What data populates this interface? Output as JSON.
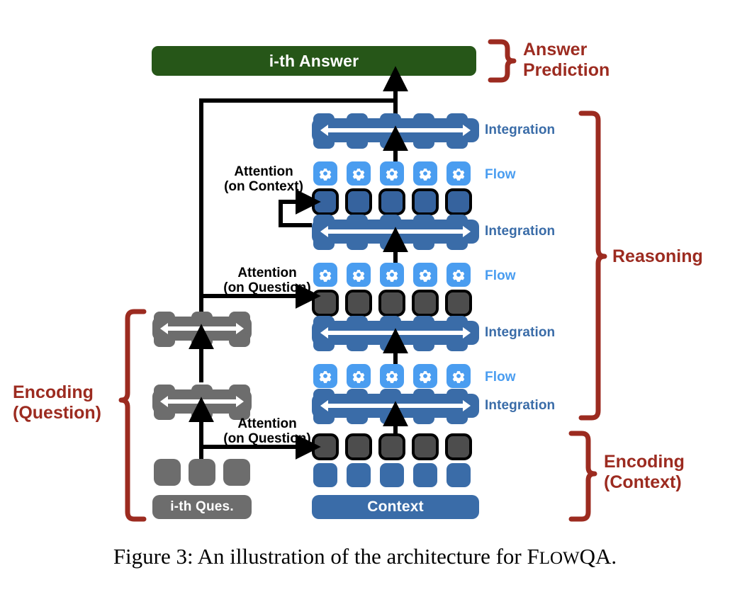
{
  "figure": {
    "caption_prefix": "Figure 3: An illustration of the architecture for ",
    "caption_smallcaps_lead": "F",
    "caption_smallcaps_rest": "LOW",
    "caption_suffix": "QA."
  },
  "colors": {
    "answer_green": "#265618",
    "integration_blue": "#3a6ca8",
    "flow_blue": "#4a9df0",
    "attention_dark_blue": "#36639e",
    "context_blue": "#3a6ca8",
    "question_gray": "#6d6d6d",
    "attention_gray": "#4d4d4d",
    "bracket_red": "#9c2b20",
    "arrow_black": "#000000",
    "label_flow": "#4a9df0",
    "label_integration": "#3a6ca8"
  },
  "answer": {
    "label": "i-th Answer"
  },
  "question": {
    "label": "i-th Ques.",
    "token_count": 3,
    "encoder_layers": 2
  },
  "context": {
    "label": "Context",
    "token_count": 5
  },
  "stack_labels": [
    {
      "text": "Integration",
      "kind": "integration"
    },
    {
      "text": "Flow",
      "kind": "flow"
    },
    {
      "text": "Integration",
      "kind": "integration"
    },
    {
      "text": "Flow",
      "kind": "flow"
    },
    {
      "text": "Integration",
      "kind": "integration"
    },
    {
      "text": "Flow",
      "kind": "flow"
    },
    {
      "text": "Integration",
      "kind": "integration"
    }
  ],
  "attention_labels": [
    {
      "line1": "Attention",
      "line2": "(on Context)"
    },
    {
      "line1": "Attention",
      "line2": "(on Question)"
    },
    {
      "line1": "Attention",
      "line2": "(on Question)"
    }
  ],
  "group_labels": [
    {
      "line1": "Answer",
      "line2": "Prediction"
    },
    {
      "line1": "Reasoning",
      "line2": ""
    },
    {
      "line1": "Encoding",
      "line2": "(Question)"
    },
    {
      "line1": "Encoding",
      "line2": "(Context)"
    }
  ]
}
